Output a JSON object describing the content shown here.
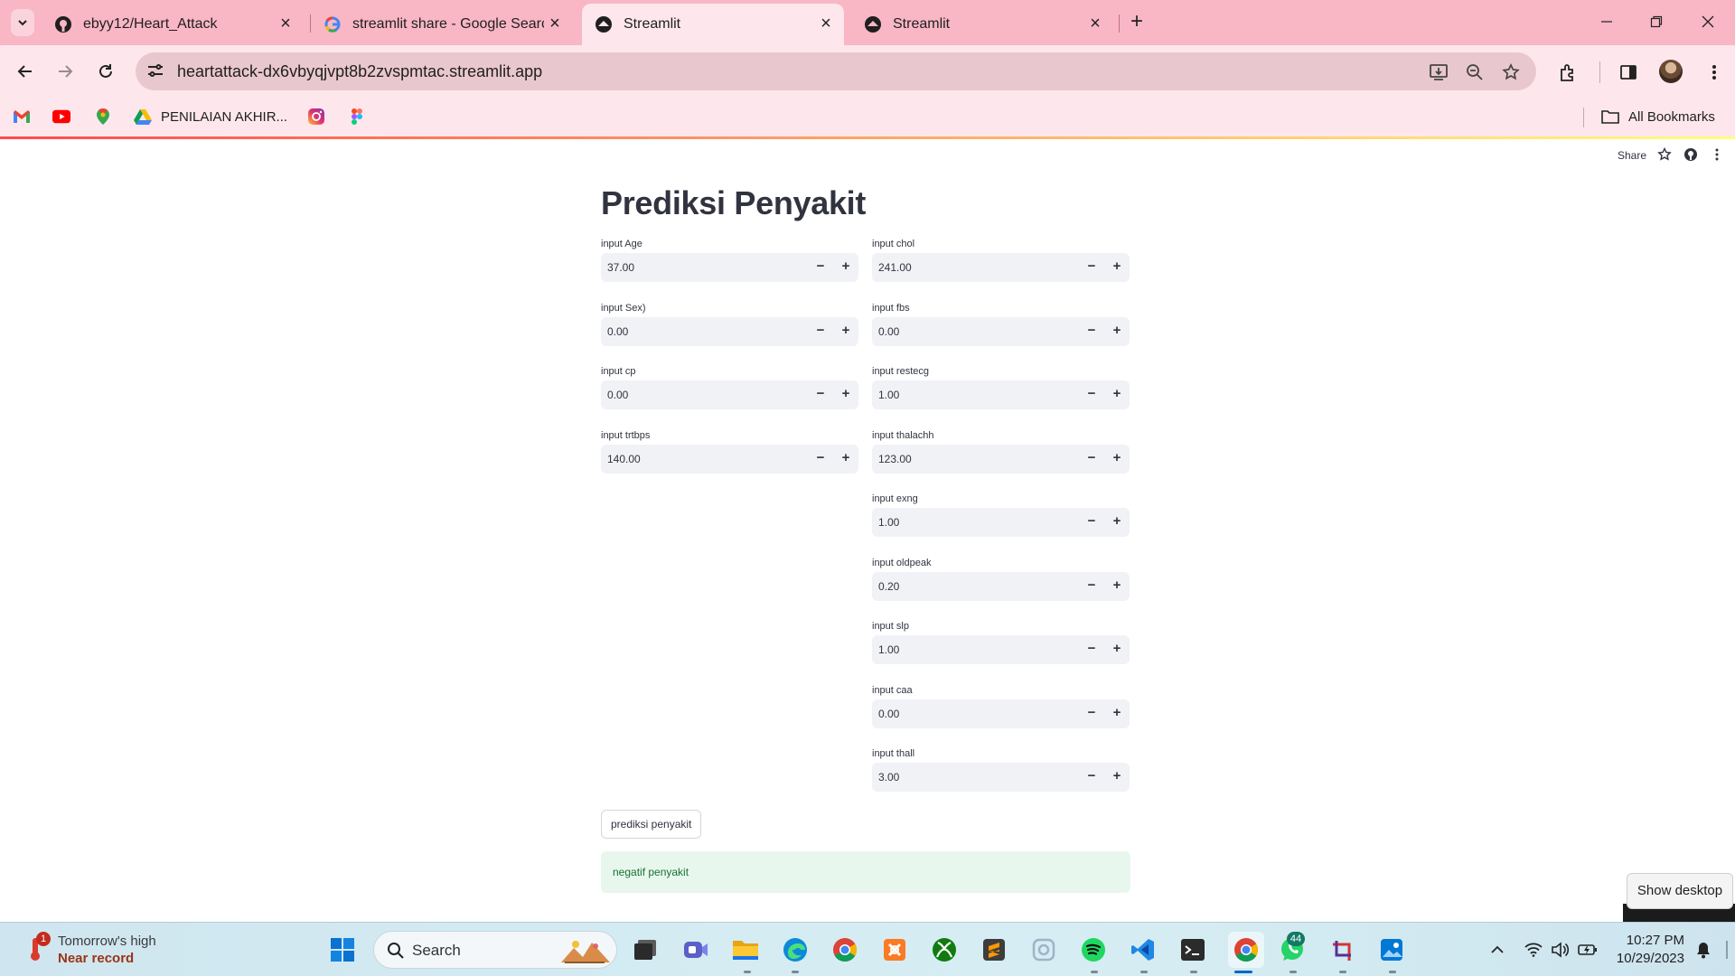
{
  "browser": {
    "tabs": [
      {
        "title": "ebyy12/Heart_Attack",
        "icon": "github-icon",
        "active": false
      },
      {
        "title": "streamlit share - Google Search",
        "icon": "google-icon",
        "active": false
      },
      {
        "title": "Streamlit",
        "icon": "streamlit-icon",
        "active": true
      },
      {
        "title": "Streamlit",
        "icon": "streamlit-icon",
        "active": false
      }
    ],
    "url": "heartattack-dx6vbyqjvpt8b2zvspmtac.streamlit.app",
    "bookmarks": [
      {
        "label": "",
        "icon": "gmail-icon"
      },
      {
        "label": "",
        "icon": "youtube-icon"
      },
      {
        "label": "",
        "icon": "maps-icon"
      },
      {
        "label": "PENILAIAN AKHIR...",
        "icon": "drive-icon"
      },
      {
        "label": "",
        "icon": "instagram-icon"
      },
      {
        "label": "",
        "icon": "figma-icon"
      }
    ],
    "all_bookmarks_label": "All Bookmarks",
    "colors": {
      "tabstrip": "#f9b6c5",
      "toolbar": "#fde7ec"
    }
  },
  "app": {
    "header": {
      "share_label": "Share"
    },
    "title": "Prediksi Penyakit",
    "left_fields": [
      {
        "label": "input Age",
        "value": "37.00"
      },
      {
        "label": "input Sex)",
        "value": "0.00"
      },
      {
        "label": "input cp",
        "value": "0.00"
      },
      {
        "label": "input trtbps",
        "value": "140.00"
      }
    ],
    "right_fields": [
      {
        "label": "input chol",
        "value": "241.00"
      },
      {
        "label": "input fbs",
        "value": "0.00"
      },
      {
        "label": "input restecg",
        "value": "1.00"
      },
      {
        "label": "input thalachh",
        "value": "123.00"
      },
      {
        "label": "input exng",
        "value": "1.00"
      },
      {
        "label": "input oldpeak",
        "value": "0.20"
      },
      {
        "label": "input slp",
        "value": "1.00"
      },
      {
        "label": "input caa",
        "value": "0.00"
      },
      {
        "label": "input thall",
        "value": "3.00"
      }
    ],
    "stepper": {
      "minus": "−",
      "plus": "+"
    },
    "predict_button": "prediksi penyakit",
    "result": "negatif penyakit",
    "colors": {
      "accent": "#ff4b4b",
      "success_bg": "#e8f7ee",
      "success_text": "#177233"
    }
  },
  "tooltip": {
    "show_desktop": "Show desktop"
  },
  "taskbar": {
    "weather": {
      "line1": "Tomorrow's high",
      "line2": "Near record",
      "badge": "1"
    },
    "search_label": "Search",
    "whatsapp_badge": "44",
    "clock": {
      "time": "10:27 PM",
      "date": "10/29/2023"
    }
  }
}
